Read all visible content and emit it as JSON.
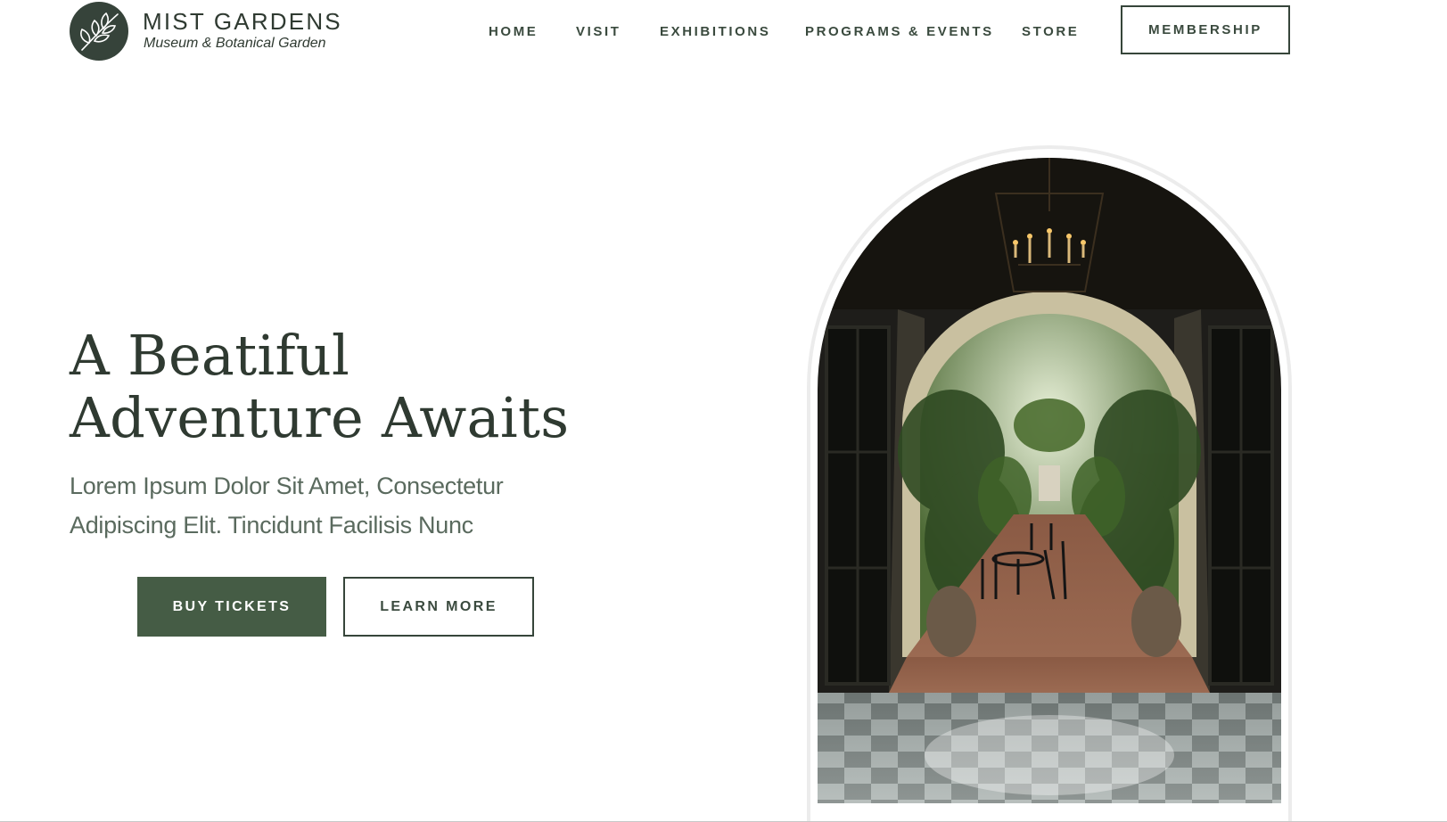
{
  "header": {
    "brand_name": "MIST GARDENS",
    "brand_tagline": "Museum & Botanical Garden",
    "logo_icon": "leaf-branch-icon",
    "nav": [
      {
        "label": "HOME"
      },
      {
        "label": "VISIT"
      },
      {
        "label": "EXHIBITIONS"
      },
      {
        "label": "PROGRAMS & EVENTS"
      },
      {
        "label": "STORE"
      }
    ],
    "membership_label": "MEMBERSHIP"
  },
  "hero": {
    "title_line1": "A Beatiful",
    "title_line2": "Adventure Awaits",
    "subtitle_line1": "Lorem Ipsum Dolor Sit Amet, Consectetur",
    "subtitle_line2": "Adipiscing Elit. Tincidunt Facilisis Nunc",
    "primary_button": "BUY TICKETS",
    "secondary_button": "LEARN MORE"
  },
  "colors": {
    "brand_dark": "#36433a",
    "button_green": "#455c45",
    "text_dark": "#2f3a31",
    "text_muted": "#5a6a5e"
  }
}
